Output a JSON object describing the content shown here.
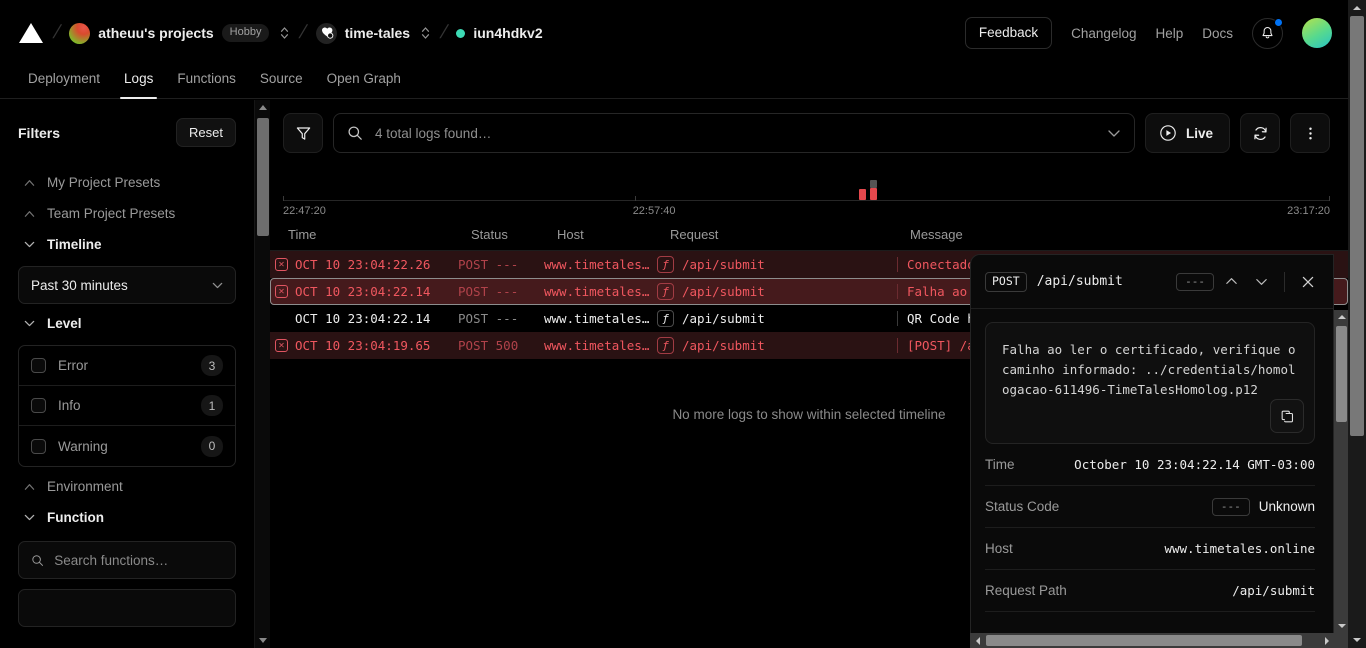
{
  "topbar": {
    "logo_icon": "vercel-triangle-icon",
    "team": {
      "name": "atheuu's projects",
      "plan_badge": "Hobby",
      "avatar_icon": "team-avatar"
    },
    "project": {
      "name": "time-tales",
      "avatar_icon": "project-avatar"
    },
    "deployment": {
      "name": "iun4hdkv2",
      "status_icon": "status-dot-ready"
    },
    "separator": "/",
    "feedback_label": "Feedback",
    "links": [
      "Changelog",
      "Help",
      "Docs"
    ],
    "notifications_icon": "bell-icon",
    "notifications_has_badge": true,
    "user_avatar_icon": "user-avatar"
  },
  "tabs": [
    {
      "label": "Deployment",
      "active": false
    },
    {
      "label": "Logs",
      "active": true
    },
    {
      "label": "Functions",
      "active": false
    },
    {
      "label": "Source",
      "active": false
    },
    {
      "label": "Open Graph",
      "active": false
    }
  ],
  "sidebar": {
    "title": "Filters",
    "reset_label": "Reset",
    "presets": [
      {
        "label": "My Project Presets",
        "expanded": false
      },
      {
        "label": "Team Project Presets",
        "expanded": false
      }
    ],
    "timeline": {
      "label": "Timeline",
      "expanded": true,
      "selected": "Past 30 minutes"
    },
    "level": {
      "label": "Level",
      "expanded": true,
      "items": [
        {
          "label": "Error",
          "count": "3",
          "checked": false
        },
        {
          "label": "Info",
          "count": "1",
          "checked": false
        },
        {
          "label": "Warning",
          "count": "0",
          "checked": false
        }
      ]
    },
    "environment": {
      "label": "Environment",
      "expanded": false
    },
    "function": {
      "label": "Function",
      "expanded": true,
      "search_placeholder": "Search functions…",
      "search_value": ""
    }
  },
  "toolbar": {
    "filter_icon": "funnel-icon",
    "search_icon": "search-icon",
    "search_placeholder": "4 total logs found…",
    "search_value": "",
    "dropdown_icon": "chevron-down-icon",
    "live_label": "Live",
    "live_icon": "play-circle-icon",
    "refresh_icon": "refresh-icon",
    "more_icon": "more-vertical-icon"
  },
  "timeline_axis": {
    "ticks": [
      "22:47:20",
      "22:57:40",
      "23:17:20"
    ],
    "bars": [
      {
        "left_pct": 55.5,
        "height": 11,
        "color": "#e5484d"
      },
      {
        "left_pct": 56.5,
        "height": 20,
        "color": "#e5484d",
        "top_color": "#545454",
        "top_height": 8
      }
    ]
  },
  "table": {
    "columns": [
      "Time",
      "Status",
      "Host",
      "Request",
      "Message"
    ],
    "rows": [
      {
        "level": "error",
        "selected": false,
        "icon": "error-x-icon",
        "time": "OCT 10 23:04:22.26",
        "method": "POST",
        "status": "---",
        "host": "www.timetales…",
        "request": "/api/submit",
        "message": "Conectado",
        "fn_icon": "lambda-icon"
      },
      {
        "level": "error",
        "selected": true,
        "icon": "error-x-icon",
        "time": "OCT 10 23:04:22.14",
        "method": "POST",
        "status": "---",
        "host": "www.timetales…",
        "request": "/api/submit",
        "message": "Falha ao",
        "fn_icon": "lambda-icon"
      },
      {
        "level": "info",
        "selected": false,
        "icon": "",
        "time": "OCT 10 23:04:22.14",
        "method": "POST",
        "status": "---",
        "host": "www.timetales…",
        "request": "/api/submit",
        "message": "QR Code h",
        "fn_icon": "lambda-icon"
      },
      {
        "level": "error",
        "selected": false,
        "icon": "error-x-icon",
        "time": "OCT 10 23:04:19.65",
        "method": "POST",
        "status": "500",
        "host": "www.timetales…",
        "request": "/api/submit",
        "message": "[POST] /a",
        "fn_icon": "lambda-icon"
      }
    ],
    "empty_notice": "No more logs to show within selected timeline"
  },
  "detail": {
    "method": "POST",
    "path": "/api/submit",
    "status_chip": "---",
    "prev_icon": "chevron-up-icon",
    "next_icon": "chevron-down-icon",
    "close_icon": "close-icon",
    "copy_icon": "copy-icon",
    "message": "Falha ao ler o certificado, verifique o caminho informado: ../credentials/homologacao-611496-TimeTalesHomolog.p12",
    "fields": [
      {
        "key": "Time",
        "value": "October 10 23:04:22.14 GMT-03:00",
        "mono": true
      },
      {
        "key": "Status Code",
        "value": "Unknown",
        "chip": "---",
        "mono": false
      },
      {
        "key": "Host",
        "value": "www.timetales.online",
        "mono": true
      },
      {
        "key": "Request Path",
        "value": "/api/submit",
        "mono": true
      }
    ]
  },
  "colors": {
    "background": "#000000",
    "error_red": "#f0575f",
    "error_row_bg": "#2a1213",
    "selected_row_bg": "#451a1c",
    "accent_teal": "#3ddbb5",
    "notification_blue": "#0072f5"
  }
}
